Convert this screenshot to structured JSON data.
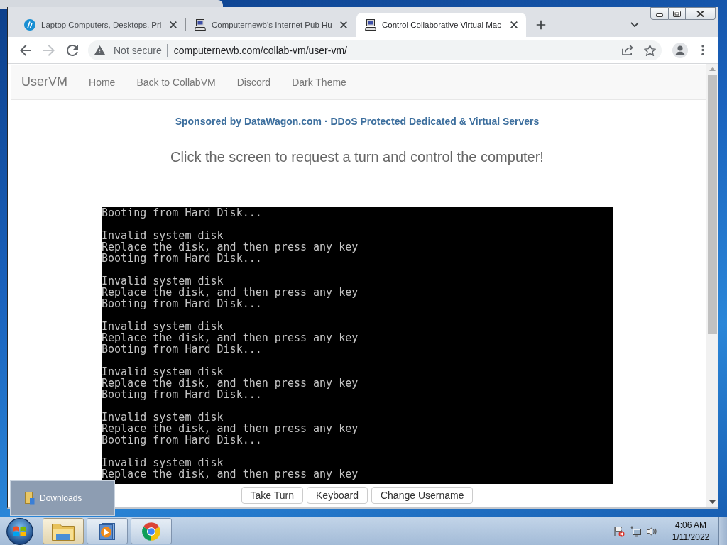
{
  "browser": {
    "tabs": [
      {
        "kind": "logo",
        "title": "Laptop Computers, Desktops, Pri",
        "selected": false
      },
      {
        "kind": "computer",
        "title": "Computernewb's Internet Pub Hu",
        "selected": false
      },
      {
        "kind": "computer",
        "title": "Control Collaborative Virtual Mac",
        "selected": true
      }
    ],
    "forward_disabled": true,
    "security_label": "Not secure",
    "url": "computernewb.com/collab-vm/user-vm/"
  },
  "navbar": {
    "brand": "UserVM",
    "links": [
      "Home",
      "Back to CollabVM",
      "Discord",
      "Dark Theme"
    ]
  },
  "sponsor": "Sponsored by DataWagon.com · DDoS Protected Dedicated & Virtual Servers",
  "heading": "Click the screen to request a turn and control the computer!",
  "vm_screen": {
    "blocks": [
      [
        "Booting from Hard Disk..."
      ],
      [
        "Invalid system disk",
        "Replace the disk, and then press any key",
        "Booting from Hard Disk..."
      ],
      [
        "Invalid system disk",
        "Replace the disk, and then press any key",
        "Booting from Hard Disk..."
      ],
      [
        "Invalid system disk",
        "Replace the disk, and then press any key",
        "Booting from Hard Disk..."
      ],
      [
        "Invalid system disk",
        "Replace the disk, and then press any key",
        "Booting from Hard Disk..."
      ],
      [
        "Invalid system disk",
        "Replace the disk, and then press any key",
        "Booting from Hard Disk..."
      ],
      [
        "Invalid system disk",
        "Replace the disk, and then press any key"
      ]
    ]
  },
  "buttons": [
    "Take Turn",
    "Keyboard",
    "Change Username"
  ],
  "taskbar": {
    "apps": [
      {
        "kind": "folder",
        "highlighted": true
      },
      {
        "kind": "player",
        "highlighted": false
      },
      {
        "kind": "browser",
        "highlighted": false
      }
    ],
    "popup": {
      "title": "Downloads"
    },
    "clock": {
      "time": "4:06 AM",
      "date": "1/11/2022"
    }
  }
}
